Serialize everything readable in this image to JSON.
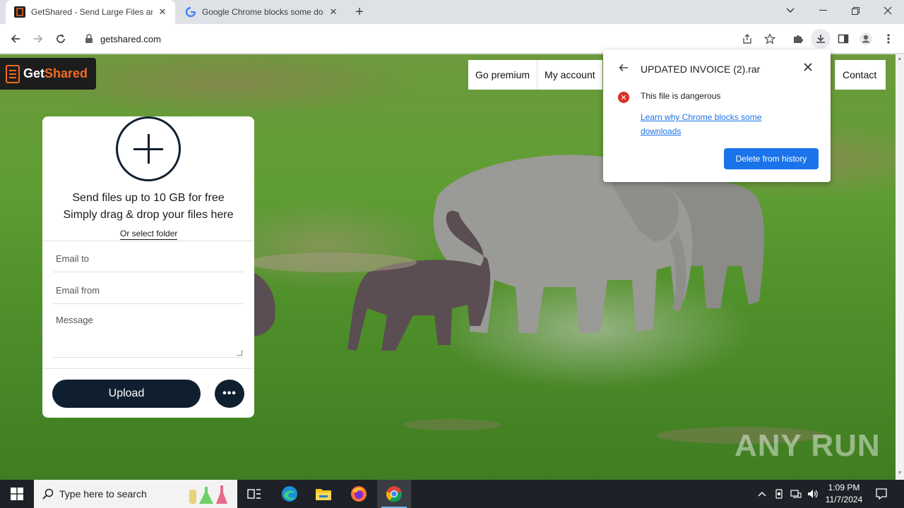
{
  "browser": {
    "tabs": [
      {
        "title": "GetShared - Send Large Files and",
        "active": true
      },
      {
        "title": "Google Chrome blocks some do",
        "active": false
      }
    ],
    "url": "getshared.com"
  },
  "site": {
    "logo_part1": "Get",
    "logo_part2": "Shared",
    "nav": [
      "Go premium",
      "My account",
      "Contact"
    ],
    "upload_panel": {
      "line1": "Send files up to 10 GB for free",
      "line2": "Simply drag & drop your files here",
      "select_folder": "Or select folder",
      "email_to_placeholder": "Email to",
      "email_from_placeholder": "Email from",
      "message_placeholder": "Message",
      "upload_label": "Upload",
      "more_label": "•••"
    },
    "watermark": "ANY RUN"
  },
  "download_popup": {
    "filename": "UPDATED INVOICE (2).rar",
    "warning": "This file is dangerous",
    "learn_link": "Learn why Chrome blocks some downloads",
    "delete_button": "Delete from history"
  },
  "taskbar": {
    "search_placeholder": "Type here to search",
    "time": "1:09 PM",
    "date": "11/7/2024"
  },
  "colors": {
    "accent_orange": "#f26b21",
    "navy": "#0f1f30",
    "chrome_blue": "#1a73e8",
    "danger_red": "#d93025"
  }
}
